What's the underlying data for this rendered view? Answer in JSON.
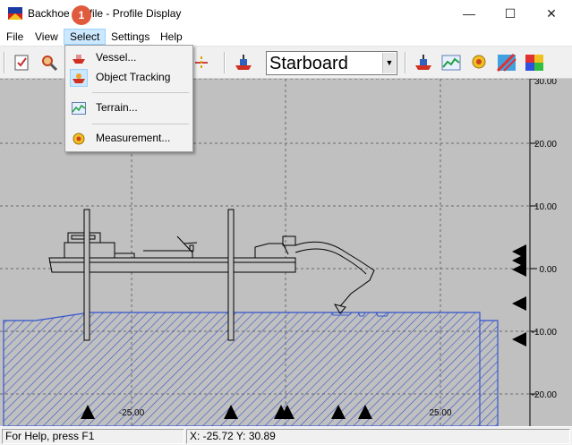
{
  "window": {
    "title": "Backhoe Profile - Profile Display",
    "badge": "1",
    "controls": {
      "minimize": "—",
      "maximize": "☐",
      "close": "✕"
    }
  },
  "menubar": {
    "items": [
      {
        "label": "File"
      },
      {
        "label": "View"
      },
      {
        "label": "Select",
        "active": true
      },
      {
        "label": "Settings"
      },
      {
        "label": "Help"
      }
    ]
  },
  "select_menu": {
    "items": [
      {
        "label": "Vessel...",
        "icon": "vessel-icon"
      },
      {
        "label": "Object Tracking",
        "icon": "tracking-icon",
        "checked": true
      },
      {
        "label": "Terrain...",
        "icon": "terrain-icon"
      },
      {
        "label": "Measurement...",
        "icon": "measurement-icon"
      }
    ]
  },
  "toolbar": {
    "view_select": {
      "value": "Starboard"
    },
    "buttons": [
      "checklist-icon",
      "zoom-icon",
      "vessel-tool-icon",
      "vessel-icon-2",
      "terrain-icon",
      "measurement-icon",
      "hatch-icon",
      "color-grid-icon"
    ]
  },
  "profile": {
    "y_axis_labels": [
      "30.00",
      "20.00",
      "10.00",
      "0.00",
      "-10.00",
      "-20.00"
    ],
    "x_axis_labels": [
      "-25.00",
      "25.00"
    ]
  },
  "statusbar": {
    "help": "For Help, press F1",
    "coords": "X: -25.72 Y: 30.89"
  },
  "colors": {
    "canvas": "#c0c0c0",
    "terrain_hatch": "#3355cc",
    "menu_highlight": "#cce8ff",
    "badge": "#e05a3e"
  }
}
